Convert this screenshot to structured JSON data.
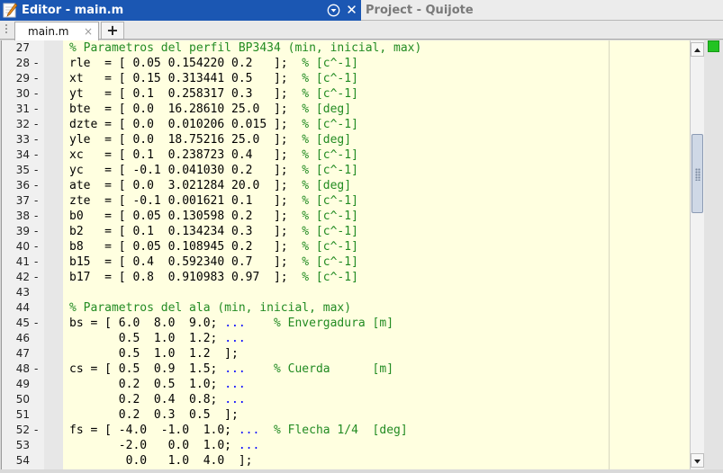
{
  "window": {
    "editor_title": "Editor - main.m",
    "project_title": "Project - Quijote",
    "close_glyph": "✕",
    "accent_color": "#1b57b3"
  },
  "tabs": {
    "items": [
      {
        "label": "main.m",
        "close_glyph": "×"
      }
    ],
    "add_label": "+"
  },
  "editor": {
    "background_color": "#ffffe0",
    "comment_color": "#228b22",
    "continuation_color": "#0000ff",
    "lines": [
      {
        "num": "27",
        "mark": "",
        "code": "",
        "comment": "% Parametros del perfil BP3434 (min, inicial, max)",
        "cont": "",
        "tail": ""
      },
      {
        "num": "28",
        "mark": "-",
        "code": "rle  = [ 0.05 0.154220 0.2   ];  ",
        "comment": "% [c^-1]",
        "cont": "",
        "tail": ""
      },
      {
        "num": "29",
        "mark": "-",
        "code": "xt   = [ 0.15 0.313441 0.5   ];  ",
        "comment": "% [c^-1]",
        "cont": "",
        "tail": ""
      },
      {
        "num": "30",
        "mark": "-",
        "code": "yt   = [ 0.1  0.258317 0.3   ];  ",
        "comment": "% [c^-1]",
        "cont": "",
        "tail": ""
      },
      {
        "num": "31",
        "mark": "-",
        "code": "bte  = [ 0.0  16.28610 25.0  ];  ",
        "comment": "% [deg]",
        "cont": "",
        "tail": ""
      },
      {
        "num": "32",
        "mark": "-",
        "code": "dzte = [ 0.0  0.010206 0.015 ];  ",
        "comment": "% [c^-1]",
        "cont": "",
        "tail": ""
      },
      {
        "num": "33",
        "mark": "-",
        "code": "yle  = [ 0.0  18.75216 25.0  ];  ",
        "comment": "% [deg]",
        "cont": "",
        "tail": ""
      },
      {
        "num": "34",
        "mark": "-",
        "code": "xc   = [ 0.1  0.238723 0.4   ];  ",
        "comment": "% [c^-1]",
        "cont": "",
        "tail": ""
      },
      {
        "num": "35",
        "mark": "-",
        "code": "yc   = [ -0.1 0.041030 0.2   ];  ",
        "comment": "% [c^-1]",
        "cont": "",
        "tail": ""
      },
      {
        "num": "36",
        "mark": "-",
        "code": "ate  = [ 0.0  3.021284 20.0  ];  ",
        "comment": "% [deg]",
        "cont": "",
        "tail": ""
      },
      {
        "num": "37",
        "mark": "-",
        "code": "zte  = [ -0.1 0.001621 0.1   ];  ",
        "comment": "% [c^-1]",
        "cont": "",
        "tail": ""
      },
      {
        "num": "38",
        "mark": "-",
        "code": "b0   = [ 0.05 0.130598 0.2   ];  ",
        "comment": "% [c^-1]",
        "cont": "",
        "tail": ""
      },
      {
        "num": "39",
        "mark": "-",
        "code": "b2   = [ 0.1  0.134234 0.3   ];  ",
        "comment": "% [c^-1]",
        "cont": "",
        "tail": ""
      },
      {
        "num": "40",
        "mark": "-",
        "code": "b8   = [ 0.05 0.108945 0.2   ];  ",
        "comment": "% [c^-1]",
        "cont": "",
        "tail": ""
      },
      {
        "num": "41",
        "mark": "-",
        "code": "b15  = [ 0.4  0.592340 0.7   ];  ",
        "comment": "% [c^-1]",
        "cont": "",
        "tail": ""
      },
      {
        "num": "42",
        "mark": "-",
        "code": "b17  = [ 0.8  0.910983 0.97  ];  ",
        "comment": "% [c^-1]",
        "cont": "",
        "tail": ""
      },
      {
        "num": "43",
        "mark": "",
        "code": "",
        "comment": "",
        "cont": "",
        "tail": ""
      },
      {
        "num": "44",
        "mark": "",
        "code": "",
        "comment": "% Parametros del ala (min, inicial, max)",
        "cont": "",
        "tail": ""
      },
      {
        "num": "45",
        "mark": "-",
        "code": "bs = [ 6.0  8.0  9.0; ",
        "comment": "",
        "cont": "...",
        "tail": "    % Envergadura [m]"
      },
      {
        "num": "46",
        "mark": "",
        "code": "       0.5  1.0  1.2; ",
        "comment": "",
        "cont": "...",
        "tail": ""
      },
      {
        "num": "47",
        "mark": "",
        "code": "       0.5  1.0  1.2  ];",
        "comment": "",
        "cont": "",
        "tail": ""
      },
      {
        "num": "48",
        "mark": "-",
        "code": "cs = [ 0.5  0.9  1.5; ",
        "comment": "",
        "cont": "...",
        "tail": "    % Cuerda      [m]"
      },
      {
        "num": "49",
        "mark": "",
        "code": "       0.2  0.5  1.0; ",
        "comment": "",
        "cont": "...",
        "tail": ""
      },
      {
        "num": "50",
        "mark": "",
        "code": "       0.2  0.4  0.8; ",
        "comment": "",
        "cont": "...",
        "tail": ""
      },
      {
        "num": "51",
        "mark": "",
        "code": "       0.2  0.3  0.5  ];",
        "comment": "",
        "cont": "",
        "tail": ""
      },
      {
        "num": "52",
        "mark": "-",
        "code": "fs = [ -4.0  -1.0  1.0; ",
        "comment": "",
        "cont": "...",
        "tail": "  % Flecha 1/4  [deg]"
      },
      {
        "num": "53",
        "mark": "",
        "code": "       -2.0   0.0  1.0; ",
        "comment": "",
        "cont": "...",
        "tail": ""
      },
      {
        "num": "54",
        "mark": "",
        "code": "        0.0   1.0  4.0  ];",
        "comment": "",
        "cont": "",
        "tail": ""
      }
    ]
  },
  "scrollbar": {
    "up_arrow": "▲",
    "down_arrow": "▼"
  }
}
